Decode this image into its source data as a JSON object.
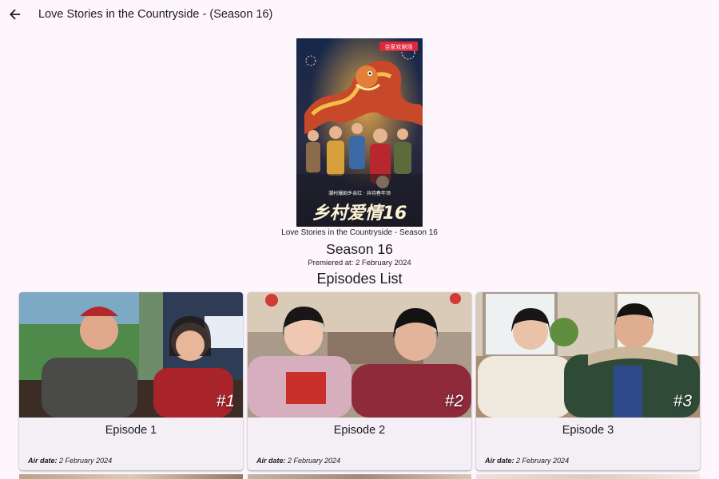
{
  "appbar": {
    "back_icon": "arrow-left-icon",
    "title": "Love Stories in the Countryside - (Season 16)"
  },
  "poster": {
    "caption": "Love Stories in the Countryside - Season 16",
    "title_text": "乡村爱情16",
    "tagline": "潮村爆剧乡亲红 · 共待春年领",
    "badge": "合家欢剧场"
  },
  "season": {
    "title": "Season 16",
    "premiered": "Premiered at: 2 February 2024"
  },
  "episodes_heading": "Episodes List",
  "episodes": [
    {
      "number": "#1",
      "title": "Episode 1",
      "air_label": "Air date:",
      "air_value": "2 February 2024"
    },
    {
      "number": "#2",
      "title": "Episode 2",
      "air_label": "Air date:",
      "air_value": "2 February 2024"
    },
    {
      "number": "#3",
      "title": "Episode 3",
      "air_label": "Air date:",
      "air_value": "2 February 2024"
    }
  ],
  "colors": {
    "background": "#fdf7fd",
    "card": "#f4eff4",
    "text": "#1c1b1f"
  }
}
